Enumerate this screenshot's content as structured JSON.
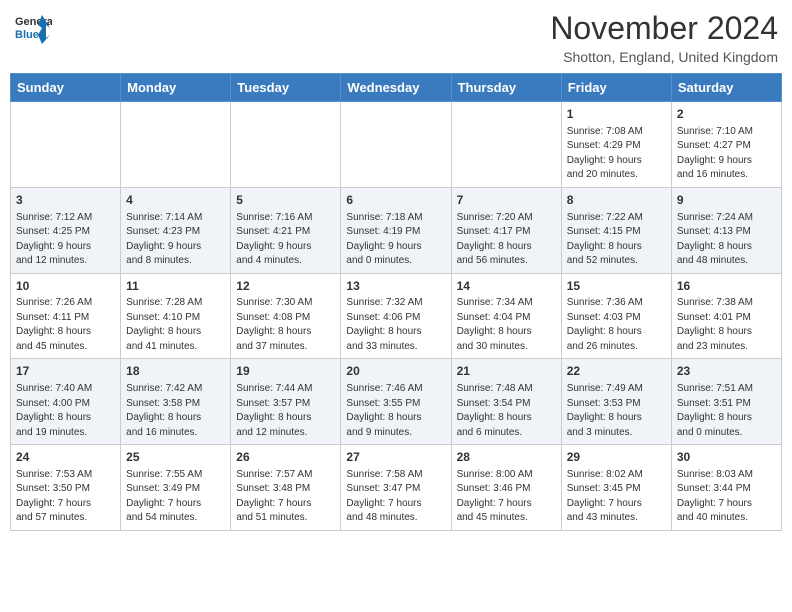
{
  "header": {
    "logo_line1": "General",
    "logo_line2": "Blue",
    "month_title": "November 2024",
    "location": "Shotton, England, United Kingdom"
  },
  "weekdays": [
    "Sunday",
    "Monday",
    "Tuesday",
    "Wednesday",
    "Thursday",
    "Friday",
    "Saturday"
  ],
  "weeks": [
    [
      {
        "day": "",
        "info": ""
      },
      {
        "day": "",
        "info": ""
      },
      {
        "day": "",
        "info": ""
      },
      {
        "day": "",
        "info": ""
      },
      {
        "day": "",
        "info": ""
      },
      {
        "day": "1",
        "info": "Sunrise: 7:08 AM\nSunset: 4:29 PM\nDaylight: 9 hours\nand 20 minutes."
      },
      {
        "day": "2",
        "info": "Sunrise: 7:10 AM\nSunset: 4:27 PM\nDaylight: 9 hours\nand 16 minutes."
      }
    ],
    [
      {
        "day": "3",
        "info": "Sunrise: 7:12 AM\nSunset: 4:25 PM\nDaylight: 9 hours\nand 12 minutes."
      },
      {
        "day": "4",
        "info": "Sunrise: 7:14 AM\nSunset: 4:23 PM\nDaylight: 9 hours\nand 8 minutes."
      },
      {
        "day": "5",
        "info": "Sunrise: 7:16 AM\nSunset: 4:21 PM\nDaylight: 9 hours\nand 4 minutes."
      },
      {
        "day": "6",
        "info": "Sunrise: 7:18 AM\nSunset: 4:19 PM\nDaylight: 9 hours\nand 0 minutes."
      },
      {
        "day": "7",
        "info": "Sunrise: 7:20 AM\nSunset: 4:17 PM\nDaylight: 8 hours\nand 56 minutes."
      },
      {
        "day": "8",
        "info": "Sunrise: 7:22 AM\nSunset: 4:15 PM\nDaylight: 8 hours\nand 52 minutes."
      },
      {
        "day": "9",
        "info": "Sunrise: 7:24 AM\nSunset: 4:13 PM\nDaylight: 8 hours\nand 48 minutes."
      }
    ],
    [
      {
        "day": "10",
        "info": "Sunrise: 7:26 AM\nSunset: 4:11 PM\nDaylight: 8 hours\nand 45 minutes."
      },
      {
        "day": "11",
        "info": "Sunrise: 7:28 AM\nSunset: 4:10 PM\nDaylight: 8 hours\nand 41 minutes."
      },
      {
        "day": "12",
        "info": "Sunrise: 7:30 AM\nSunset: 4:08 PM\nDaylight: 8 hours\nand 37 minutes."
      },
      {
        "day": "13",
        "info": "Sunrise: 7:32 AM\nSunset: 4:06 PM\nDaylight: 8 hours\nand 33 minutes."
      },
      {
        "day": "14",
        "info": "Sunrise: 7:34 AM\nSunset: 4:04 PM\nDaylight: 8 hours\nand 30 minutes."
      },
      {
        "day": "15",
        "info": "Sunrise: 7:36 AM\nSunset: 4:03 PM\nDaylight: 8 hours\nand 26 minutes."
      },
      {
        "day": "16",
        "info": "Sunrise: 7:38 AM\nSunset: 4:01 PM\nDaylight: 8 hours\nand 23 minutes."
      }
    ],
    [
      {
        "day": "17",
        "info": "Sunrise: 7:40 AM\nSunset: 4:00 PM\nDaylight: 8 hours\nand 19 minutes."
      },
      {
        "day": "18",
        "info": "Sunrise: 7:42 AM\nSunset: 3:58 PM\nDaylight: 8 hours\nand 16 minutes."
      },
      {
        "day": "19",
        "info": "Sunrise: 7:44 AM\nSunset: 3:57 PM\nDaylight: 8 hours\nand 12 minutes."
      },
      {
        "day": "20",
        "info": "Sunrise: 7:46 AM\nSunset: 3:55 PM\nDaylight: 8 hours\nand 9 minutes."
      },
      {
        "day": "21",
        "info": "Sunrise: 7:48 AM\nSunset: 3:54 PM\nDaylight: 8 hours\nand 6 minutes."
      },
      {
        "day": "22",
        "info": "Sunrise: 7:49 AM\nSunset: 3:53 PM\nDaylight: 8 hours\nand 3 minutes."
      },
      {
        "day": "23",
        "info": "Sunrise: 7:51 AM\nSunset: 3:51 PM\nDaylight: 8 hours\nand 0 minutes."
      }
    ],
    [
      {
        "day": "24",
        "info": "Sunrise: 7:53 AM\nSunset: 3:50 PM\nDaylight: 7 hours\nand 57 minutes."
      },
      {
        "day": "25",
        "info": "Sunrise: 7:55 AM\nSunset: 3:49 PM\nDaylight: 7 hours\nand 54 minutes."
      },
      {
        "day": "26",
        "info": "Sunrise: 7:57 AM\nSunset: 3:48 PM\nDaylight: 7 hours\nand 51 minutes."
      },
      {
        "day": "27",
        "info": "Sunrise: 7:58 AM\nSunset: 3:47 PM\nDaylight: 7 hours\nand 48 minutes."
      },
      {
        "day": "28",
        "info": "Sunrise: 8:00 AM\nSunset: 3:46 PM\nDaylight: 7 hours\nand 45 minutes."
      },
      {
        "day": "29",
        "info": "Sunrise: 8:02 AM\nSunset: 3:45 PM\nDaylight: 7 hours\nand 43 minutes."
      },
      {
        "day": "30",
        "info": "Sunrise: 8:03 AM\nSunset: 3:44 PM\nDaylight: 7 hours\nand 40 minutes."
      }
    ]
  ]
}
